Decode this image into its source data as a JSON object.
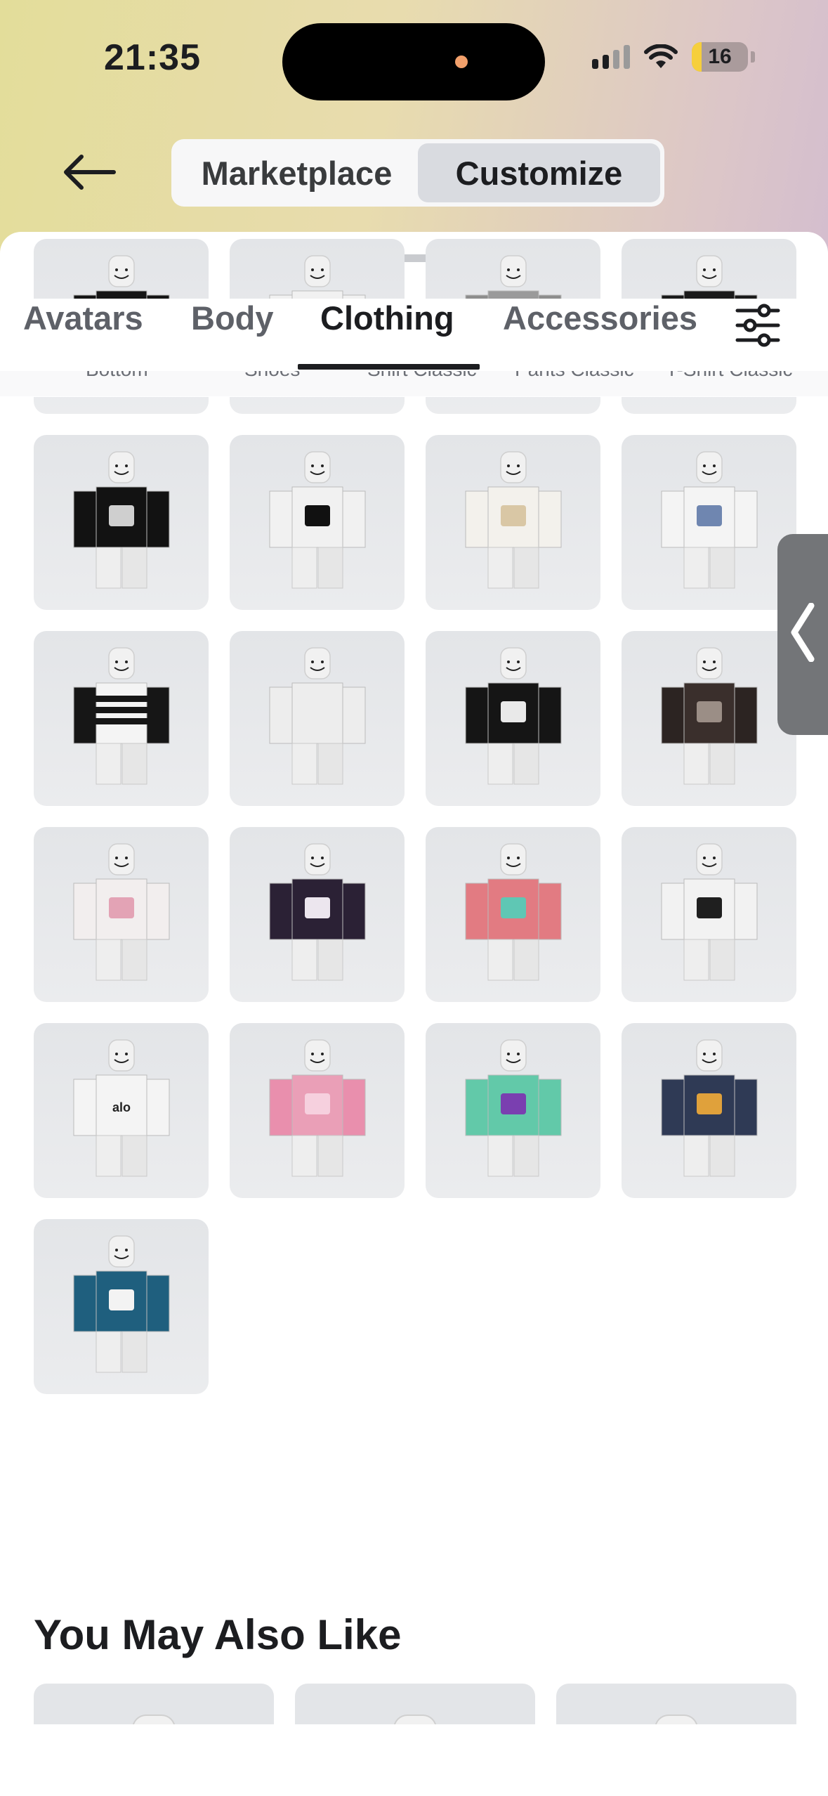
{
  "status_bar": {
    "time": "21:35",
    "battery": "16"
  },
  "nav": {
    "segments": [
      "Marketplace",
      "Customize"
    ],
    "active_segment": "Customize"
  },
  "tabs": {
    "items": [
      "Avatars",
      "Body",
      "Clothing",
      "Accessories"
    ],
    "active": "Clothing"
  },
  "subcategories": [
    "Bottom",
    "Shoes",
    "Shirt Classic",
    "Pants Classic",
    "T-Shirt Classic"
  ],
  "grid": {
    "items": [
      {
        "shirt": "#151515",
        "sleeves": "#151515",
        "detail": "none"
      },
      {
        "shirt": "#f1f1f1",
        "sleeves": "#f1f1f1",
        "detail": "none"
      },
      {
        "shirt": "#9a9a9a",
        "sleeves": "#8d8d8d",
        "detail": "#7fbf7a"
      },
      {
        "shirt": "#1a1a1a",
        "sleeves": "#1a1a1a",
        "detail": "none"
      },
      {
        "shirt": "#121212",
        "sleeves": "#121212",
        "detail": "#cfcfcf"
      },
      {
        "shirt": "#f1f1f1",
        "sleeves": "#f1f1f1",
        "detail": "#111111"
      },
      {
        "shirt": "#f3f1ec",
        "sleeves": "#f3f1ec",
        "detail": "#d9c7a5"
      },
      {
        "shirt": "#f4f4f4",
        "sleeves": "#f4f4f4",
        "detail": "#6f86b0"
      },
      {
        "shirt": "#f4f4f4",
        "sleeves": "#161616",
        "detail": "stripes"
      },
      {
        "shirt": "#ededed",
        "sleeves": "#ededed",
        "detail": "none"
      },
      {
        "shirt": "#151515",
        "sleeves": "#151515",
        "detail": "#e9e9e9"
      },
      {
        "shirt": "#3a2f2c",
        "sleeves": "#2c2422",
        "detail": "#9b8e86"
      },
      {
        "shirt": "#f2eeee",
        "sleeves": "#f2eeee",
        "detail": "#e3a3b5"
      },
      {
        "shirt": "#2b2135",
        "sleeves": "#2b2135",
        "detail": "#ece6ee"
      },
      {
        "shirt": "#e27b82",
        "sleeves": "#e27b82",
        "detail": "#5fc7b4"
      },
      {
        "shirt": "#f2f2f2",
        "sleeves": "#f2f2f2",
        "detail": "#1f1f1f"
      },
      {
        "shirt": "#f4f4f4",
        "sleeves": "#f4f4f4",
        "detail": "alo"
      },
      {
        "shirt": "#ea9fb7",
        "sleeves": "#e98fad",
        "detail": "#f6d0de"
      },
      {
        "shirt": "#62c9a9",
        "sleeves": "#62c9a9",
        "detail": "#7a3fb0"
      },
      {
        "shirt": "#2f3a55",
        "sleeves": "#2f3a55",
        "detail": "#e0a13b"
      },
      {
        "shirt": "#1f5f7e",
        "sleeves": "#1f5f7e",
        "detail": "#f3f3f3"
      }
    ]
  },
  "section": {
    "title": "You May Also Like"
  },
  "colors": {
    "accent": "#1c1d20",
    "tile_bg": "#e3e5e8",
    "sheet_bg": "#ffffff"
  }
}
